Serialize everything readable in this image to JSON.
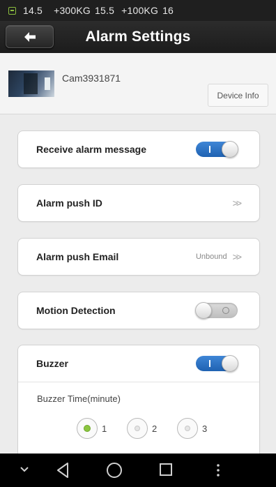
{
  "status_bar": {
    "items": [
      "14.5",
      "+300KG",
      "15.5",
      "+100KG",
      "16"
    ]
  },
  "header": {
    "title": "Alarm Settings",
    "back_icon": "back-arrow-icon"
  },
  "device": {
    "name": "Cam3931871",
    "info_button": "Device Info"
  },
  "settings": {
    "receive_alarm": {
      "label": "Receive alarm message",
      "enabled": true
    },
    "push_id": {
      "label": "Alarm push ID",
      "value": ""
    },
    "push_email": {
      "label": "Alarm push Email",
      "value": "Unbound"
    },
    "motion_detection": {
      "label": "Motion Detection",
      "enabled": false
    },
    "buzzer": {
      "label": "Buzzer",
      "enabled": true,
      "time_label": "Buzzer Time(minute)",
      "options": [
        "1",
        "2",
        "3"
      ],
      "selected": "1"
    }
  },
  "nav": {
    "icons": [
      "chevron-down-icon",
      "back-triangle-icon",
      "home-circle-icon",
      "recents-square-icon",
      "overflow-dots-icon"
    ]
  },
  "colors": {
    "toggle_on": "#2a70c4",
    "radio_selected": "#8bc53f",
    "title_bar": "#222222"
  }
}
